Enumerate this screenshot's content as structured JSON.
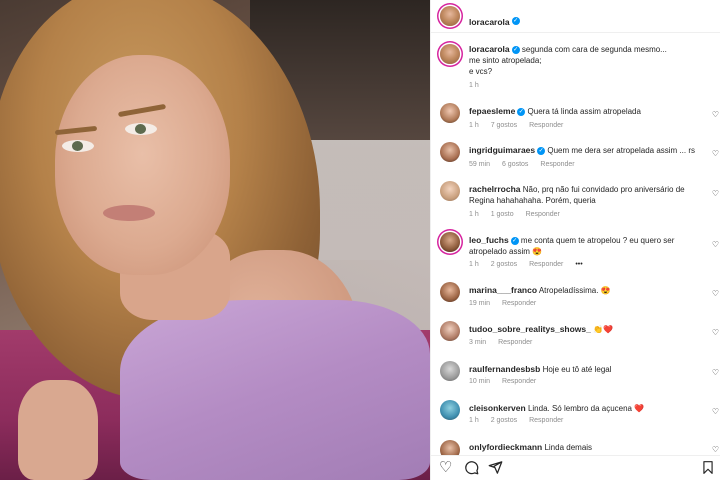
{
  "post": {
    "author": "loracarola",
    "caption_line1": "segunda com cara de segunda mesmo...",
    "caption_line2": "me sinto atropelada;",
    "caption_line3": "e vcs?",
    "time": "1 h"
  },
  "comments": [
    {
      "user": "fepaesleme",
      "verified": true,
      "text": "Quera tá linda assim atropelada",
      "time": "1 h",
      "likes": "7 gostos",
      "reply": "Responder"
    },
    {
      "user": "ingridguimaraes",
      "verified": true,
      "text": "Quem me dera ser atropelada assim ... rs",
      "time": "59 min",
      "likes": "6 gostos",
      "reply": "Responder"
    },
    {
      "user": "rachelrrocha",
      "verified": false,
      "text": "Não, prq não fui convidado pro aniversário de Regina hahahahaha. Porém, queria",
      "time": "1 h",
      "likes": "1 gosto",
      "reply": "Responder"
    },
    {
      "user": "leo_fuchs",
      "verified": true,
      "text": "me conta quem te atropelou ? eu quero ser atropelado assim 😍",
      "time": "1 h",
      "likes": "2 gostos",
      "reply": "Responder",
      "more": "•••"
    },
    {
      "user": "marina___franco",
      "verified": false,
      "text": "Atropeladíssima. 😍",
      "time": "19 min",
      "likes": "",
      "reply": "Responder"
    },
    {
      "user": "tudoo_sobre_realitys_shows_",
      "verified": false,
      "text": "👏❤️",
      "time": "3 min",
      "likes": "",
      "reply": "Responder"
    },
    {
      "user": "raulfernandesbsb",
      "verified": false,
      "text": "Hoje eu tô até legal",
      "time": "10 min",
      "likes": "",
      "reply": "Responder"
    },
    {
      "user": "cleisonkerven",
      "verified": false,
      "text": "Linda. Só lembro da açucena ❤️",
      "time": "1 h",
      "likes": "2 gostos",
      "reply": "Responder"
    },
    {
      "user": "onlyfordieckmann",
      "verified": false,
      "text": "Linda demais",
      "time": "",
      "likes": "",
      "reply": ""
    }
  ],
  "icons": {
    "heart": "♡",
    "comment": "◯",
    "share": "➢",
    "bookmark": "⛉"
  },
  "colors": {
    "verified": "#0095f6",
    "meta": "#8e8e8e",
    "text": "#262626"
  }
}
